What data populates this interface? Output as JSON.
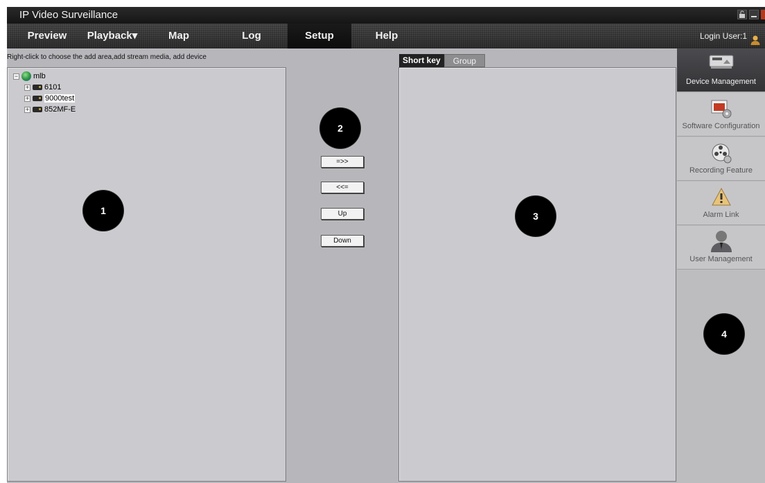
{
  "window": {
    "title": "IP Video Surveillance",
    "controls": [
      "lock-icon",
      "minimize-icon",
      "close-icon"
    ]
  },
  "menu": {
    "items": [
      "Preview",
      "Playback",
      "Map",
      "Log",
      "Setup",
      "Help"
    ],
    "playback_arrow": "▾",
    "active": "Setup",
    "login_label": "Login User:1"
  },
  "hint": "Right-click to choose the add area,add stream media, add device",
  "tree": {
    "root": "mlb",
    "devices": [
      "6101",
      "9000test",
      "852MF-E"
    ],
    "selected": "9000test"
  },
  "transfer_buttons": {
    "add": "=>>",
    "remove": "<<=",
    "up": "Up",
    "down": "Down"
  },
  "tabs": {
    "short_key": "Short key",
    "group": "Group",
    "active": "Short key"
  },
  "sidebar": {
    "items": [
      {
        "label": "Device Management",
        "icon": "monitor-icon"
      },
      {
        "label": "Software Configuration",
        "icon": "software-config-icon"
      },
      {
        "label": "Recording Feature",
        "icon": "film-reel-icon"
      },
      {
        "label": "Alarm Link",
        "icon": "warning-icon"
      },
      {
        "label": "User Management",
        "icon": "user-icon"
      }
    ],
    "active": "Device Management"
  },
  "markers": {
    "m1": "1",
    "m2": "2",
    "m3": "3",
    "m4": "4"
  }
}
